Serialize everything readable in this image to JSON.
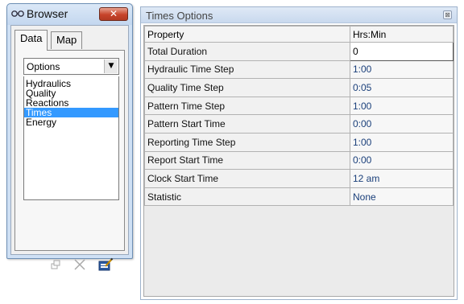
{
  "browser": {
    "title": "Browser",
    "close_label": "✕",
    "tabs": [
      {
        "label": "Data",
        "active": true
      },
      {
        "label": "Map",
        "active": false
      }
    ],
    "dropdown": {
      "value": "Options",
      "arrow": "▼"
    },
    "list_items": [
      {
        "label": "Hydraulics",
        "selected": false
      },
      {
        "label": "Quality",
        "selected": false
      },
      {
        "label": "Reactions",
        "selected": false
      },
      {
        "label": "Times",
        "selected": true
      },
      {
        "label": "Energy",
        "selected": false
      }
    ],
    "actions": [
      "add-icon",
      "delete-icon",
      "edit-icon"
    ]
  },
  "options": {
    "title": "Times Options",
    "close_label": "⊠",
    "headers": [
      "Property",
      "Hrs:Min"
    ],
    "rows": [
      {
        "property": "Total Duration",
        "value": "0",
        "editing": true
      },
      {
        "property": "Hydraulic Time Step",
        "value": "1:00",
        "editing": false
      },
      {
        "property": "Quality Time Step",
        "value": "0:05",
        "editing": false
      },
      {
        "property": "Pattern Time Step",
        "value": "1:00",
        "editing": false
      },
      {
        "property": "Pattern Start Time",
        "value": "0:00",
        "editing": false
      },
      {
        "property": "Reporting Time Step",
        "value": "1:00",
        "editing": false
      },
      {
        "property": "Report Start Time",
        "value": "0:00",
        "editing": false
      },
      {
        "property": "Clock Start Time",
        "value": "12 am",
        "editing": false
      },
      {
        "property": "Statistic",
        "value": "None",
        "editing": false
      }
    ]
  },
  "colors": {
    "selection": "#3399ff",
    "value_text": "#1a3f7a",
    "close_button": "#c7432a"
  }
}
